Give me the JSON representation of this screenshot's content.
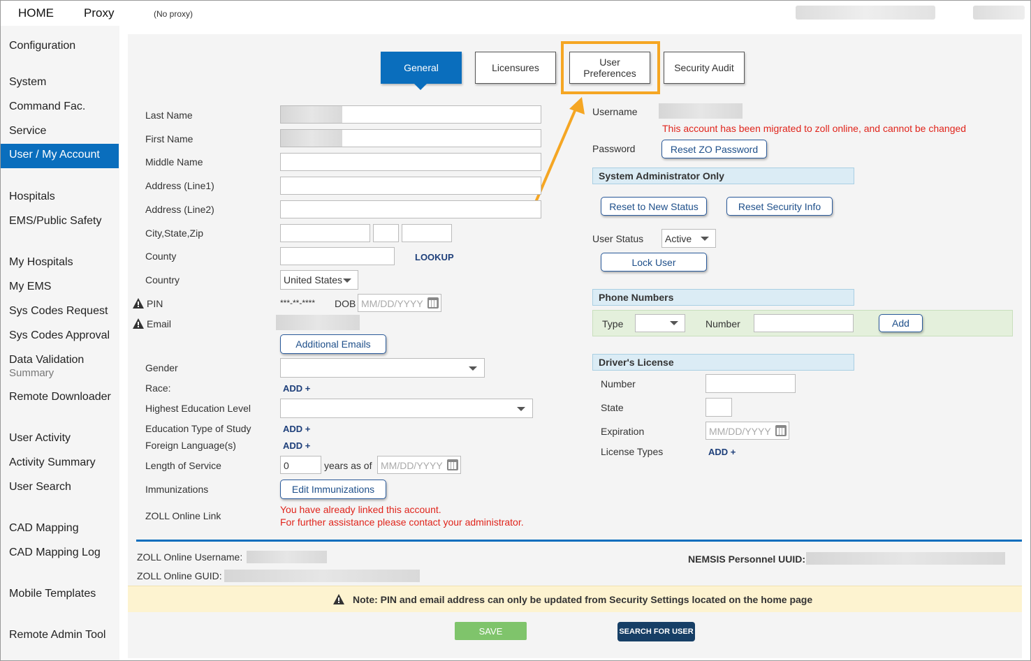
{
  "topbar": {
    "home": "HOME",
    "proxy": "Proxy",
    "proxy_status": "(No proxy)"
  },
  "sidebar": {
    "items": [
      "Configuration",
      "System",
      "Command Fac.",
      "Service",
      "User / My Account",
      "Hospitals",
      "EMS/Public Safety",
      "My Hospitals",
      "My EMS",
      "Sys Codes Request",
      "Sys Codes Approval",
      "Data Validation",
      "Remote Downloader",
      "User Activity",
      "Activity Summary",
      "User Search",
      "CAD Mapping",
      "CAD Mapping Log",
      "Mobile Templates",
      "Remote Admin Tool"
    ],
    "sub": "Summary"
  },
  "tabs": {
    "general": "General",
    "licensures": "Licensures",
    "user_prefs_1": "User",
    "user_prefs_2": "Preferences",
    "security_audit": "Security Audit"
  },
  "form": {
    "last_name": "Last Name",
    "first_name": "First Name",
    "middle_name": "Middle Name",
    "addr1": "Address (Line1)",
    "addr2": "Address (Line2)",
    "city": "City,State,Zip",
    "county": "County",
    "lookup": "LOOKUP",
    "country": "Country",
    "country_value": "United States",
    "pin": "PIN",
    "pin_value": "***-**-****",
    "dob": "DOB",
    "dob_placeholder": "MM/DD/YYYY",
    "email": "Email",
    "additional_emails": "Additional Emails",
    "gender": "Gender",
    "race": "Race:",
    "add": "ADD +",
    "edu_level": "Highest Education Level",
    "edu_type": "Education Type of Study",
    "foreign_lang": "Foreign Language(s)",
    "length_service": "Length of Service",
    "length_value": "0",
    "years_as_of": "years as of",
    "years_placeholder": "MM/DD/YYYY",
    "immunizations": "Immunizations",
    "edit_immunizations": "Edit Immunizations",
    "zoll_link": "ZOLL Online Link",
    "zoll_msg1": "You have already linked this account.",
    "zoll_msg2": "For further assistance please contact your administrator."
  },
  "account": {
    "username": "Username",
    "migrated_msg": "This account has been migrated to zoll online, and cannot be changed",
    "password": "Password",
    "reset_zo": "Reset ZO Password",
    "sys_admin": "System Administrator Only",
    "reset_new": "Reset to New Status",
    "reset_security": "Reset Security Info",
    "user_status": "User Status",
    "status_value": "Active",
    "lock_user": "Lock User"
  },
  "phone": {
    "header": "Phone Numbers",
    "type": "Type",
    "number": "Number",
    "add": "Add"
  },
  "license": {
    "header": "Driver's License",
    "number": "Number",
    "state": "State",
    "expiration": "Expiration",
    "exp_placeholder": "MM/DD/YYYY",
    "types": "License Types",
    "add": "ADD +"
  },
  "footer": {
    "zo_username": "ZOLL Online Username:",
    "zo_guid": "ZOLL Online GUID:",
    "nemsis": "NEMSIS Personnel UUID:",
    "note": "Note: PIN and email address can only be updated from Security Settings located on the home page",
    "save": "SAVE",
    "search": "SEARCH FOR USER"
  },
  "colors": {
    "accent": "#0a6ebd",
    "callout": "#f5a623",
    "error": "#e0241b",
    "save": "#7fc46b",
    "search": "#173f66"
  }
}
